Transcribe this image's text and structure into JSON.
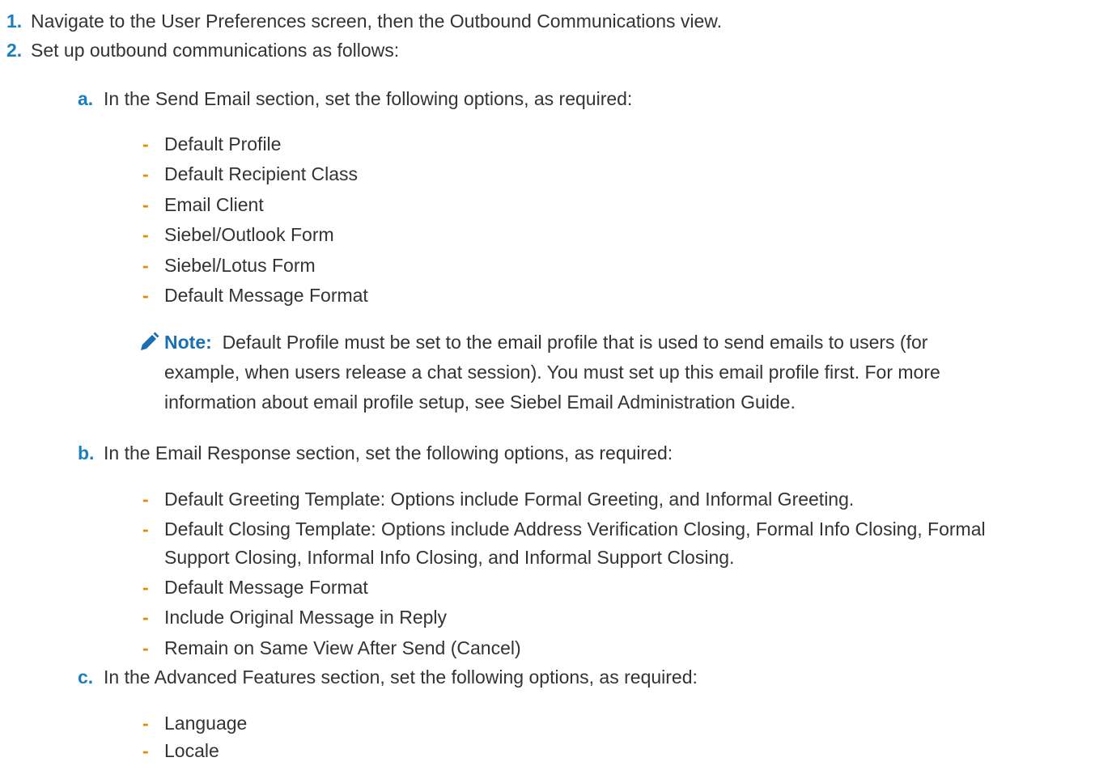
{
  "steps": [
    {
      "marker": "1.",
      "text": "Navigate to the User Preferences screen, then the Outbound Communications view."
    },
    {
      "marker": "2.",
      "text": "Set up outbound communications as follows:",
      "substeps": [
        {
          "marker": "a.",
          "text": "In the Send Email section, set the following options, as required:",
          "items": [
            "Default Profile",
            "Default Recipient Class",
            "Email Client",
            "Siebel/Outlook Form",
            "Siebel/Lotus Form",
            "Default Message Format"
          ],
          "note": {
            "icon": "pencil-icon",
            "label": "Note:",
            "lines": [
              "Default Profile must be set to the email profile that is used to send emails to users (for",
              "example, when users release a chat session). You must set up this email profile first. For more",
              "information about email profile setup, see Siebel Email Administration Guide."
            ]
          }
        },
        {
          "marker": "b.",
          "text": "In the Email Response section, set the following options, as required:",
          "items": [
            [
              "Default Greeting Template: Options include Formal Greeting, and Informal Greeting."
            ],
            [
              "Default Closing Template: Options include Address Verification Closing, Formal Info Closing, Formal",
              "Support Closing, Informal Info Closing, and Informal Support Closing."
            ],
            [
              "Default Message Format"
            ],
            [
              "Include Original Message in Reply"
            ],
            [
              "Remain on Same View After Send (Cancel)"
            ]
          ]
        },
        {
          "marker": "c.",
          "text": "In the Advanced Features section, set the following options, as required:",
          "items": [
            "Language",
            "Locale"
          ]
        }
      ]
    }
  ],
  "bullet_char": "-",
  "colors": {
    "step_marker": "#1a7fc1",
    "bullet": "#e68a00",
    "note_label": "#1a6fb3",
    "text": "#333333"
  }
}
